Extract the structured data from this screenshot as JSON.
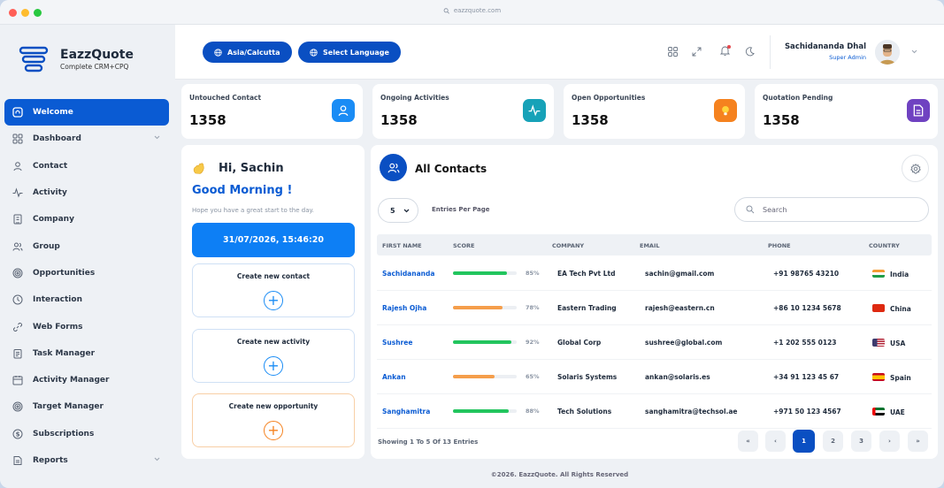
{
  "browser": {
    "url": "eazzquote.com"
  },
  "brand": {
    "name": "EazzQuote",
    "tagline": "Complete CRM+CPQ"
  },
  "sidebar": {
    "items": [
      {
        "label": "Welcome",
        "icon": "home-icon",
        "active": true
      },
      {
        "label": "Dashboard",
        "icon": "grid-icon",
        "has_submenu": true
      },
      {
        "label": "Contact",
        "icon": "user-icon"
      },
      {
        "label": "Activity",
        "icon": "activity-icon"
      },
      {
        "label": "Company",
        "icon": "building-icon"
      },
      {
        "label": "Group",
        "icon": "group-icon"
      },
      {
        "label": "Opportunities",
        "icon": "target-icon"
      },
      {
        "label": "Interaction",
        "icon": "clock-icon"
      },
      {
        "label": "Web Forms",
        "icon": "link-icon"
      },
      {
        "label": "Task Manager",
        "icon": "clipboard-icon"
      },
      {
        "label": "Activity Manager",
        "icon": "calendar-icon"
      },
      {
        "label": "Target Manager",
        "icon": "target-icon"
      },
      {
        "label": "Subscriptions",
        "icon": "dollar-icon"
      },
      {
        "label": "Reports",
        "icon": "report-icon",
        "has_submenu": true
      }
    ]
  },
  "topbar": {
    "timezone_label": "Asia/Calcutta",
    "language_label": "Select Language",
    "user_name": "Sachidananda Dhal",
    "user_role": "Super Admin"
  },
  "stats": [
    {
      "label": "Untouched Contact",
      "value": "1358",
      "icon": "user-icon",
      "color": "#1a8cf5"
    },
    {
      "label": "Ongoing Activities",
      "value": "1358",
      "icon": "activity-icon",
      "color": "#17a2b8"
    },
    {
      "label": "Open Opportunities",
      "value": "1358",
      "icon": "lightbulb-icon",
      "color": "#f5821f"
    },
    {
      "label": "Quotation Pending",
      "value": "1358",
      "icon": "document-icon",
      "color": "#6f42c1"
    }
  ],
  "welcome": {
    "greeting": "Hi, Sachin",
    "time_greeting": "Good Morning !",
    "subtitle": "Hope you have a great start to the day.",
    "datetime": "31/07/2026, 15:46:20",
    "actions": [
      {
        "label": "Create new contact",
        "color": "#1a8cf5"
      },
      {
        "label": "Create new activity",
        "color": "#1a8cf5"
      },
      {
        "label": "Create new opportunity",
        "color": "#f5821f"
      }
    ]
  },
  "contacts": {
    "title": "All Contacts",
    "per_page": "5",
    "per_page_label": "Entries Per Page",
    "search_placeholder": "Search",
    "columns": [
      "FIRST NAME",
      "SCORE",
      "COMPANY",
      "EMAIL",
      "PHONE",
      "COUNTRY"
    ],
    "rows": [
      {
        "name": "Sachidananda",
        "score": 85,
        "score_label": "85%",
        "score_color": "#22c55e",
        "company": "EA Tech Pvt Ltd",
        "email": "sachin@gmail.com",
        "phone": "+91 98765 43210",
        "country": "India",
        "flag": "india"
      },
      {
        "name": "Rajesh Ojha",
        "score": 78,
        "score_label": "78%",
        "score_color": "#f59e4b",
        "company": "Eastern Trading",
        "email": "rajesh@eastern.cn",
        "phone": "+86 10 1234 5678",
        "country": "China",
        "flag": "china"
      },
      {
        "name": "Sushree",
        "score": 92,
        "score_label": "92%",
        "score_color": "#22c55e",
        "company": "Global Corp",
        "email": "sushree@global.com",
        "phone": "+1 202 555 0123",
        "country": "USA",
        "flag": "usa"
      },
      {
        "name": "Ankan",
        "score": 65,
        "score_label": "65%",
        "score_color": "#f59e4b",
        "company": "Solaris Systems",
        "email": "ankan@solaris.es",
        "phone": "+34 91 123 45 67",
        "country": "Spain",
        "flag": "spain"
      },
      {
        "name": "Sanghamitra",
        "score": 88,
        "score_label": "88%",
        "score_color": "#22c55e",
        "company": "Tech Solutions",
        "email": "sanghamitra@techsol.ae",
        "phone": "+971 50 123 4567",
        "country": "UAE",
        "flag": "uae"
      }
    ],
    "showing": "Showing 1 To 5 Of 13 Entries",
    "pagination": [
      "«",
      "‹",
      "1",
      "2",
      "3",
      "›",
      "»"
    ],
    "current_page": "1"
  },
  "footer": "©2026. EazzQuote. All Rights Reserved"
}
